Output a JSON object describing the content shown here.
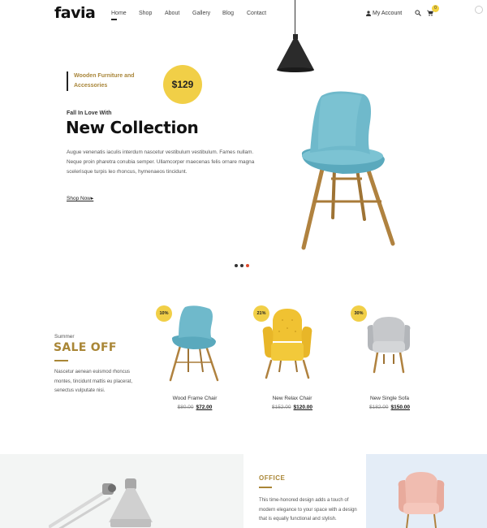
{
  "header": {
    "logo": "favia",
    "nav": [
      "Home",
      "Shop",
      "About",
      "Gallery",
      "Blog",
      "Contact"
    ],
    "account_label": "My Account",
    "cart_count": "0"
  },
  "hero": {
    "category": "Wooden Furniture and Accessories",
    "price": "$129",
    "eyebrow": "Fall In Love With",
    "title": "New Collection",
    "description": "Augue venenatis iaculis interdum nascetur vestibulum vestibulum. Fames nullam. Neque proin pharetra conubia semper. Ullamcorper maecenas felis ornare magna scelerisque turpis leo rhoncus, hymenaeos tincidunt.",
    "cta": "Shop Now"
  },
  "sale": {
    "eyebrow": "Summer",
    "title": "SALE OFF",
    "description": "Nascetur aenean euismod rhoncus montes, tincidunt mattis eu placerat, senectus vulputate nisi."
  },
  "products": [
    {
      "badge": "10%",
      "name": "Wood Frame Chair",
      "old_price": "$80.00",
      "new_price": "$72.00"
    },
    {
      "badge": "21%",
      "name": "New Relax Chair",
      "old_price": "$152.00",
      "new_price": "$120.00"
    },
    {
      "badge": "30%",
      "name": "New Single Sofa",
      "old_price": "$182.00",
      "new_price": "$150.00"
    }
  ],
  "office": {
    "title": "OFFICE",
    "description": "This time-honored design adds a touch of modern elegance to your space with a design that is equally functional and stylish."
  },
  "colors": {
    "hero_bg": "#e4edf7",
    "accent_yellow": "#f1cf47",
    "accent_gold": "#a98636",
    "chair_blue": "#6fb8c9",
    "dot_active": "#e04a2d"
  }
}
